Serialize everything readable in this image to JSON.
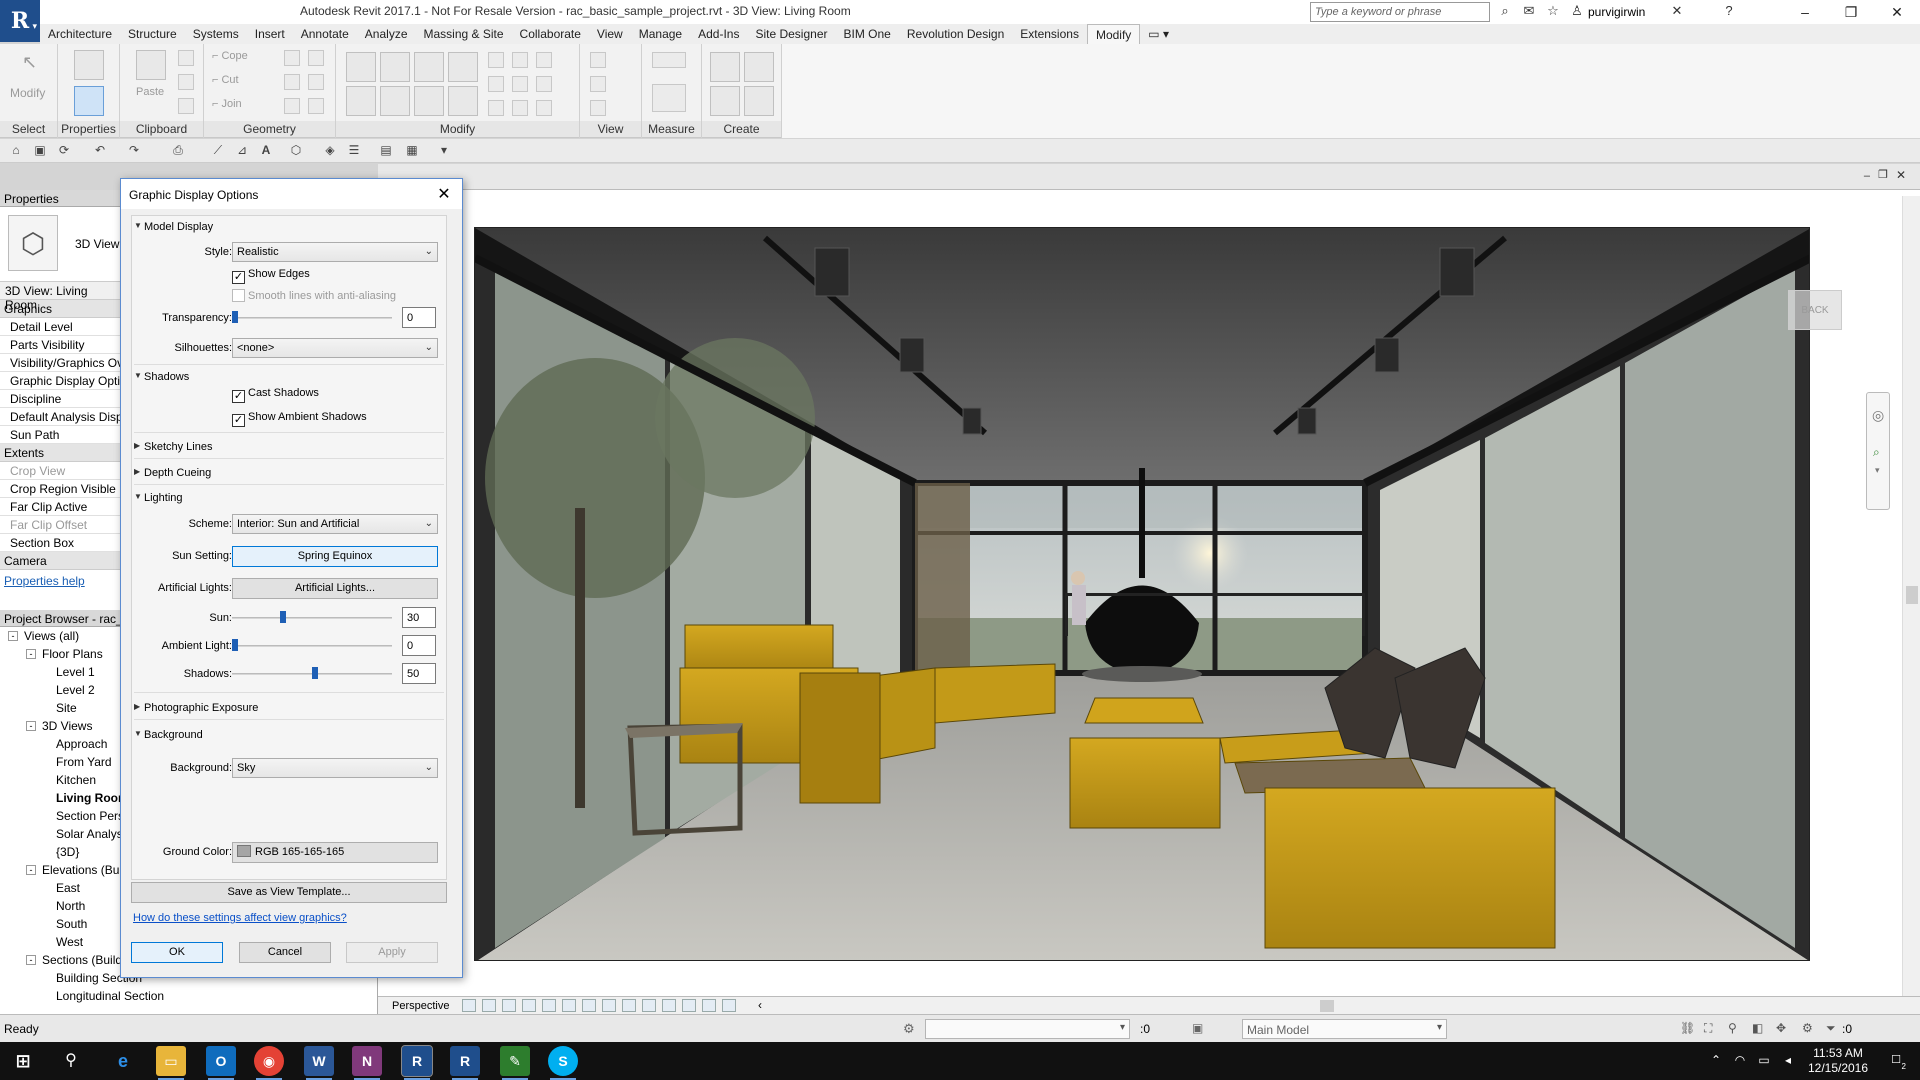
{
  "title_bar": {
    "logo": "R",
    "title": "Autodesk Revit 2017.1 -  Not For Resale Version -     rac_basic_sample_project.rvt - 3D View: Living Room",
    "search_placeholder": "Type a keyword or phrase",
    "username": "purvigirwin"
  },
  "ribbon_tabs": [
    "Architecture",
    "Structure",
    "Systems",
    "Insert",
    "Annotate",
    "Analyze",
    "Massing & Site",
    "Collaborate",
    "View",
    "Manage",
    "Add-Ins",
    "Site Designer",
    "BIM One",
    "Revolution Design",
    "Extensions",
    "Modify"
  ],
  "active_tab": "Modify",
  "ribbon": {
    "modify_label": "Modify",
    "paste_label": "Paste",
    "cope_label": "Cope",
    "cut_label": "Cut",
    "join_label": "Join",
    "panels": {
      "select": "Select",
      "properties": "Properties",
      "clipboard": "Clipboard",
      "geometry": "Geometry",
      "modify": "Modify",
      "view": "View",
      "measure": "Measure",
      "create": "Create"
    }
  },
  "properties": {
    "title": "Properties",
    "type_name": "3D View",
    "instance": "3D View: Living Room",
    "groups": [
      {
        "name": "Graphics",
        "rows": [
          {
            "label": "Detail Level",
            "dim": false
          },
          {
            "label": "Parts Visibility",
            "dim": false
          },
          {
            "label": "Visibility/Graphics Overrides",
            "dim": false
          },
          {
            "label": "Graphic Display Options",
            "dim": false
          },
          {
            "label": "Discipline",
            "dim": false
          },
          {
            "label": "Default Analysis Display Style",
            "dim": false
          },
          {
            "label": "Sun Path",
            "dim": false
          }
        ]
      },
      {
        "name": "Extents",
        "rows": [
          {
            "label": "Crop View",
            "dim": true
          },
          {
            "label": "Crop Region Visible",
            "dim": false
          },
          {
            "label": "Far Clip Active",
            "dim": false
          },
          {
            "label": "Far Clip Offset",
            "dim": true
          },
          {
            "label": "Section Box",
            "dim": false
          }
        ]
      },
      {
        "name": "Camera",
        "rows": []
      }
    ],
    "help_link": "Properties help"
  },
  "browser": {
    "title": "Project Browser - rac_basic_sample_project.rvt",
    "items": [
      {
        "label": "Views (all)",
        "level": 0,
        "toggle": "-",
        "bold": false
      },
      {
        "label": "Floor Plans",
        "level": 1,
        "toggle": "-",
        "bold": false
      },
      {
        "label": "Level 1",
        "level": 2,
        "toggle": "",
        "bold": false
      },
      {
        "label": "Level 2",
        "level": 2,
        "toggle": "",
        "bold": false
      },
      {
        "label": "Site",
        "level": 2,
        "toggle": "",
        "bold": false
      },
      {
        "label": "3D Views",
        "level": 1,
        "toggle": "-",
        "bold": false
      },
      {
        "label": "Approach",
        "level": 2,
        "toggle": "",
        "bold": false
      },
      {
        "label": "From Yard",
        "level": 2,
        "toggle": "",
        "bold": false
      },
      {
        "label": "Kitchen",
        "level": 2,
        "toggle": "",
        "bold": false
      },
      {
        "label": "Living Room",
        "level": 2,
        "toggle": "",
        "bold": true
      },
      {
        "label": "Section Perspective",
        "level": 2,
        "toggle": "",
        "bold": false
      },
      {
        "label": "Solar Analysis",
        "level": 2,
        "toggle": "",
        "bold": false
      },
      {
        "label": "{3D}",
        "level": 2,
        "toggle": "",
        "bold": false
      },
      {
        "label": "Elevations (Building Elevation)",
        "level": 1,
        "toggle": "-",
        "bold": false
      },
      {
        "label": "East",
        "level": 2,
        "toggle": "",
        "bold": false
      },
      {
        "label": "North",
        "level": 2,
        "toggle": "",
        "bold": false
      },
      {
        "label": "South",
        "level": 2,
        "toggle": "",
        "bold": false
      },
      {
        "label": "West",
        "level": 2,
        "toggle": "",
        "bold": false
      },
      {
        "label": "Sections (Building Section)",
        "level": 1,
        "toggle": "-",
        "bold": false
      },
      {
        "label": "Building Section",
        "level": 2,
        "toggle": "",
        "bold": false
      },
      {
        "label": "Longitudinal Section",
        "level": 2,
        "toggle": "",
        "bold": false
      }
    ]
  },
  "dialog": {
    "title": "Graphic Display Options",
    "model_display": {
      "header": "Model Display",
      "style_label": "Style:",
      "style_value": "Realistic",
      "show_edges": "Show Edges",
      "smooth_lines": "Smooth lines with anti-aliasing",
      "transparency_label": "Transparency:",
      "transparency_value": "0",
      "silhouettes_label": "Silhouettes:",
      "silhouettes_value": "<none>"
    },
    "shadows": {
      "header": "Shadows",
      "cast": "Cast Shadows",
      "ambient": "Show Ambient Shadows"
    },
    "sketchy_lines": "Sketchy Lines",
    "depth_cueing": "Depth Cueing",
    "lighting": {
      "header": "Lighting",
      "scheme_label": "Scheme:",
      "scheme_value": "Interior: Sun and Artificial",
      "sun_setting_label": "Sun Setting:",
      "sun_setting_value": "Spring Equinox",
      "artificial_label": "Artificial Lights:",
      "artificial_button": "Artificial Lights...",
      "sun_label": "Sun:",
      "sun_value": "30",
      "ambient_label": "Ambient Light:",
      "ambient_value": "0",
      "shadows_label": "Shadows:",
      "shadows_value": "50"
    },
    "photographic_exposure": "Photographic Exposure",
    "background": {
      "header": "Background",
      "background_label": "Background:",
      "background_value": "Sky",
      "ground_label": "Ground Color:",
      "ground_value": "RGB 165-165-165"
    },
    "save_template": "Save as View Template...",
    "help_link": "How do these settings affect view graphics?",
    "ok": "OK",
    "cancel": "Cancel",
    "apply": "Apply"
  },
  "view": {
    "viewcube_label": "BACK",
    "perspective_label": "Perspective"
  },
  "status_bar": {
    "status": "Ready",
    "workset_count": ":0",
    "model": "Main Model",
    "filter_count": ":0"
  },
  "taskbar": {
    "time": "11:53 AM",
    "date": "12/15/2016",
    "notifications": "2"
  },
  "colors": {
    "accent_blue": "#1e5fb5",
    "revit_blue": "#1f4e8c",
    "taskbar": "#111111",
    "sofa_yellow": "#c8a017"
  }
}
